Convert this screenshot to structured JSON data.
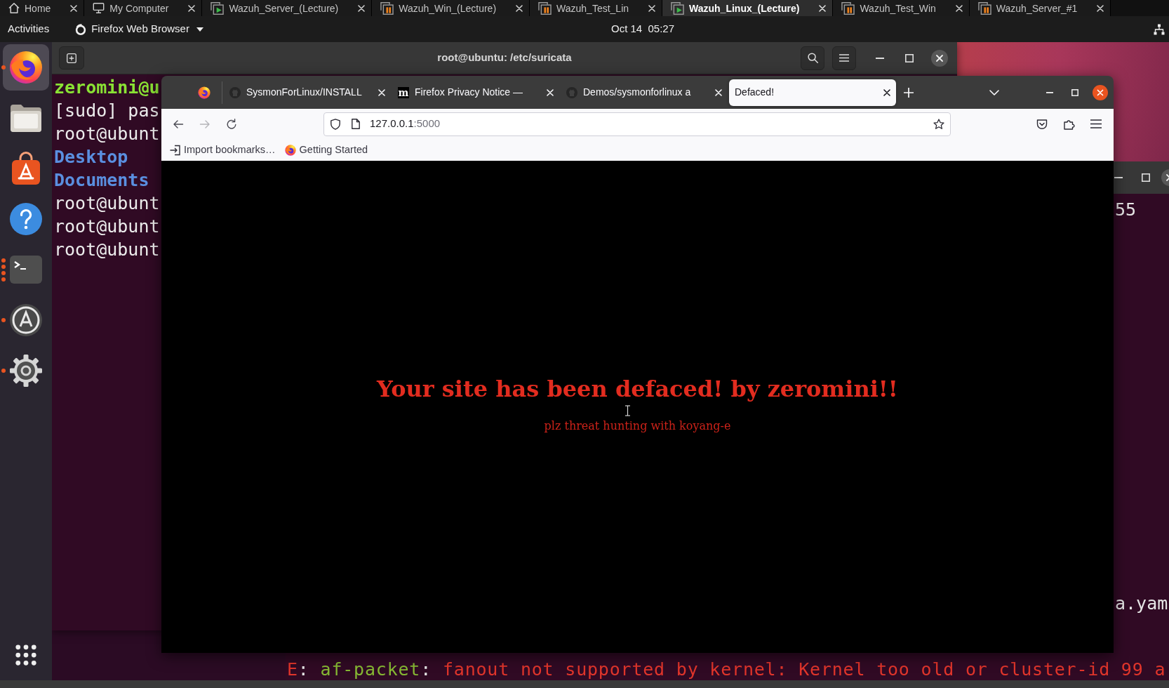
{
  "vm_tabs": [
    {
      "label": "Home",
      "kind": "home",
      "selected": false
    },
    {
      "label": "My Computer",
      "kind": "computer",
      "selected": false
    },
    {
      "label": "Wazuh_Server_(Lecture)",
      "kind": "running",
      "selected": false
    },
    {
      "label": "Wazuh_Win_(Lecture)",
      "kind": "paused",
      "selected": false
    },
    {
      "label": "Wazuh_Test_Lin",
      "kind": "paused",
      "selected": false
    },
    {
      "label": "Wazuh_Linux_(Lecture)",
      "kind": "running",
      "selected": true
    },
    {
      "label": "Wazuh_Test_Win",
      "kind": "paused",
      "selected": false
    },
    {
      "label": "Wazuh_Server_#1",
      "kind": "paused",
      "selected": false
    }
  ],
  "top_bar": {
    "activities": "Activities",
    "app_menu": "Firefox Web Browser",
    "clock": "Oct 14  05:27"
  },
  "dock": {
    "items": [
      {
        "kind": "firefox",
        "active": true,
        "running": true,
        "multiple_windows": false
      },
      {
        "kind": "files",
        "active": false,
        "running": false,
        "multiple_windows": false
      },
      {
        "kind": "app-center",
        "active": false,
        "running": false,
        "multiple_windows": false
      },
      {
        "kind": "help",
        "active": false,
        "running": false,
        "multiple_windows": false
      },
      {
        "kind": "terminal",
        "active": false,
        "running": true,
        "multiple_windows": true
      },
      {
        "kind": "updater",
        "active": false,
        "running": true,
        "multiple_windows": false
      },
      {
        "kind": "settings",
        "active": false,
        "running": true,
        "multiple_windows": false
      }
    ]
  },
  "terminal": {
    "title": "root@ubuntu: /etc/suricata",
    "lines": [
      {
        "kind": "prompt",
        "text": "zeromini@u"
      },
      {
        "kind": "output",
        "text": "[sudo] pas"
      },
      {
        "kind": "output",
        "text": "root@ubunt"
      },
      {
        "kind": "directory",
        "text": "Desktop"
      },
      {
        "kind": "directory",
        "text": "Documents"
      },
      {
        "kind": "output",
        "text": "root@ubunt"
      },
      {
        "kind": "output",
        "text": "root@ubunt"
      },
      {
        "kind": "output",
        "text": "root@ubunt"
      }
    ]
  },
  "terminal_2": {
    "lines": [
      {
        "text": "55"
      },
      {
        "text": "a.yam"
      }
    ],
    "last_line": [
      {
        "kind": "error",
        "text": "E"
      },
      {
        "kind": "plain",
        "text": ": "
      },
      {
        "kind": "module",
        "text": "af-packet"
      },
      {
        "kind": "plain",
        "text": ": "
      },
      {
        "kind": "error",
        "text": "fanout not supported by kernel: Kernel too old or cluster-id 99 a"
      }
    ]
  },
  "browser": {
    "tabs": [
      {
        "title": "SysmonForLinux/INSTALL",
        "kind": "github",
        "selected": false
      },
      {
        "title": "Firefox Privacy Notice —",
        "kind": "letter",
        "favicon_text": "m",
        "selected": false
      },
      {
        "title": "Demos/sysmonforlinux a",
        "kind": "github",
        "selected": false
      },
      {
        "title": "Defaced!",
        "kind": "plain",
        "selected": true
      }
    ],
    "nav": [
      {
        "kind": "back",
        "disabled": false
      },
      {
        "kind": "forward",
        "disabled": true
      },
      {
        "kind": "reload",
        "disabled": false
      }
    ],
    "address": {
      "host": "127.0.0.1",
      "port": ":5000"
    },
    "bookmarks": [
      {
        "kind": "import",
        "label": "Import bookmarks…"
      },
      {
        "kind": "firefox",
        "label": "Getting Started"
      }
    ],
    "page": {
      "heading": "Your site has been defaced! by zeromini!!",
      "subtitle": "plz threat hunting with koyang-e"
    }
  }
}
